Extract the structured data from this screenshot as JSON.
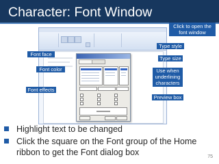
{
  "title": "Character: Font Window",
  "callouts": {
    "open_font_window": "Click to open the font window",
    "type_style": "Type style",
    "font_face": "Font face",
    "type_size": "Type size",
    "font_color": "Font color",
    "underlining": "Use when underlining characters",
    "font_effects": "Font effects",
    "preview_box": "Preview box"
  },
  "bullets": [
    "Highlight text to be changed",
    "Click the square on the Font group of the Home ribbon to get the Font dialog box"
  ],
  "page_number": "75",
  "colors": {
    "title_bar": "#17375e",
    "callout_bg": "#1f5ba6",
    "bullet": "#1f5ba6",
    "text": "#262626"
  }
}
